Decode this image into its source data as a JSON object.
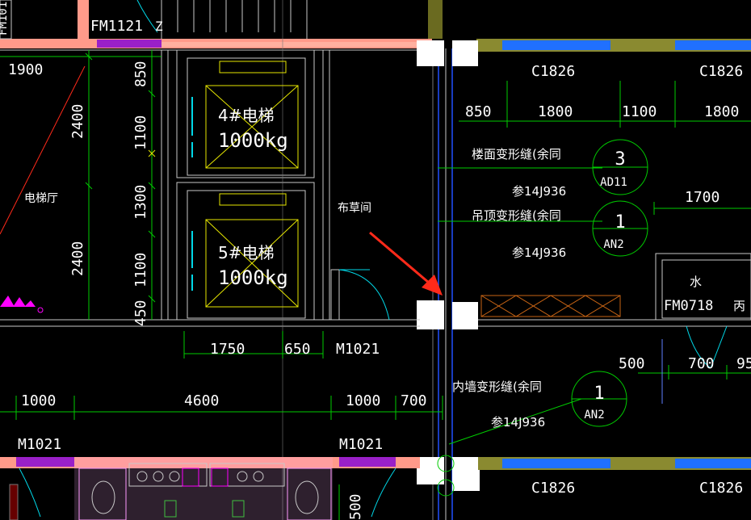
{
  "drawing": {
    "room_labels": {
      "elevator_hall": "电梯厅",
      "linen_room": "布草间",
      "water": "水",
      "c_char": "丙"
    },
    "elevators": [
      {
        "name": "4#电梯",
        "capacity": "1000kg"
      },
      {
        "name": "5#电梯",
        "capacity": "1000kg"
      }
    ],
    "doors": {
      "fm1121": "FM1121",
      "fm_top": "FM101",
      "z_char": "Z",
      "fm0718": "FM0718",
      "m1021_mid": "M1021",
      "m1021_left": "M1021",
      "m1021_right": "M1021"
    },
    "windows": {
      "c1826_1": "C1826",
      "c1826_2": "C1826",
      "c1826_3": "C1826",
      "c1826_4": "C1826"
    },
    "notes": {
      "floor_joint": "楼面变形缝(余同",
      "ceiling_joint": "吊顶变形缝(余同",
      "wall_joint": "内墙变形缝(余同",
      "ref1": "参14J936",
      "ref2": "参14J936",
      "ref3": "参14J936"
    },
    "bubbles": [
      {
        "num": "3",
        "code": "AD11"
      },
      {
        "num": "1",
        "code": "AN2"
      },
      {
        "num": "1",
        "code": "AN2"
      }
    ],
    "dims": {
      "d1900": "1900",
      "d2400a": "2400",
      "d2400b": "2400",
      "d850v": "850",
      "d1100a": "1100",
      "d1300": "1300",
      "d1100b": "1100",
      "d450": "450",
      "d1750": "1750",
      "d650": "650",
      "d850": "850",
      "d1800a": "1800",
      "d1100": "1100",
      "d1800b": "1800",
      "d1700": "1700",
      "d500": "500",
      "d700r": "700",
      "d95": "95",
      "d1000a": "1000",
      "d4600": "4600",
      "d1000b": "1000",
      "d700": "700",
      "d500v": "500"
    },
    "colors": {
      "background": "#000000",
      "dimension": "#00cc00",
      "wall": "#c8c8c8",
      "elevator": "#e6e600",
      "door_swing": "#00d8e8",
      "column": "#ff9a8a",
      "window": "#8a8a30",
      "magenta": "#ff00ff",
      "red_arrow": "#ff2a1a",
      "note_text": "#ffffff",
      "orange_hatch": "#c86414"
    }
  }
}
